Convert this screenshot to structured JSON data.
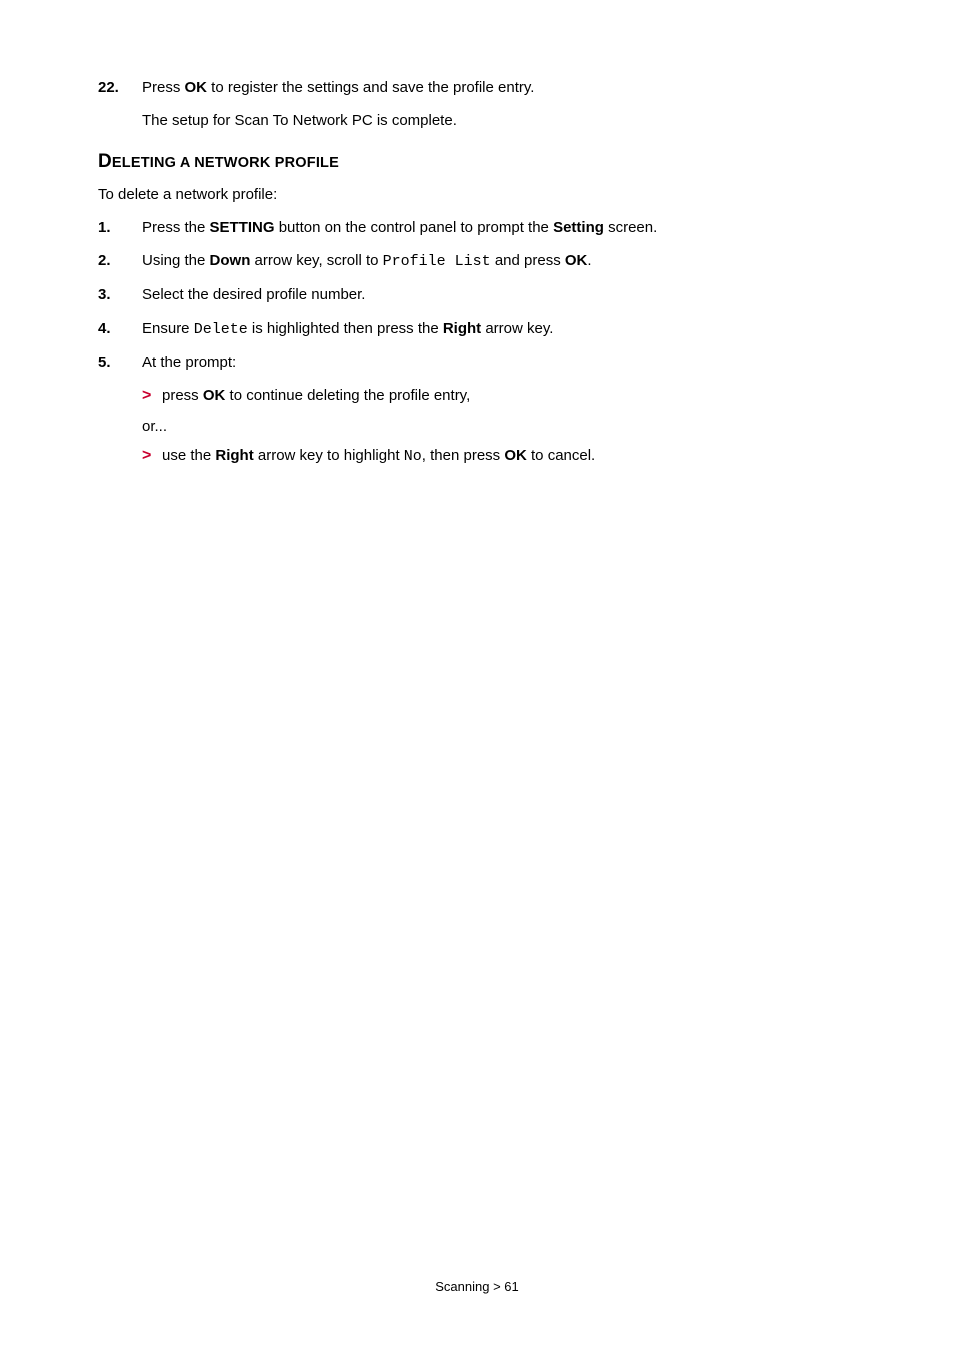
{
  "steps_top": [
    {
      "num": "22.",
      "pieces": [
        "Press ",
        "OK",
        " to register the settings and save the profile entry."
      ]
    }
  ],
  "top_followup": "The setup for Scan To Network PC is complete.",
  "heading": {
    "lead": "D",
    "rest": "ELETING A NETWORK PROFILE"
  },
  "intro": "To delete a network profile:",
  "steps": [
    {
      "num": "1.",
      "pieces": [
        "Press the ",
        "SETTING",
        " button on the control panel to prompt the ",
        "Setting",
        " screen."
      ]
    },
    {
      "num": "2.",
      "pieces": [
        "Using the ",
        "Down",
        " arrow key, scroll to ",
        {
          "mono": "Profile List"
        },
        " and press ",
        "OK",
        "."
      ]
    },
    {
      "num": "3.",
      "pieces": [
        "Select the desired profile number."
      ]
    },
    {
      "num": "4.",
      "pieces": [
        "Ensure ",
        {
          "mono": "Delete"
        },
        " is highlighted then press the ",
        "Right",
        " arrow key."
      ]
    },
    {
      "num": "5.",
      "pieces": [
        "At the prompt:"
      ]
    }
  ],
  "sub": [
    {
      "chev": ">",
      "pieces": [
        "press ",
        "OK",
        " to continue deleting the profile entry,"
      ]
    },
    {
      "or": "or..."
    },
    {
      "chev": ">",
      "pieces": [
        "use the ",
        "Right",
        " arrow key to highlight ",
        {
          "mono": "No"
        },
        ", then press ",
        "OK",
        " to cancel."
      ]
    }
  ],
  "footer": "Scanning > 61"
}
